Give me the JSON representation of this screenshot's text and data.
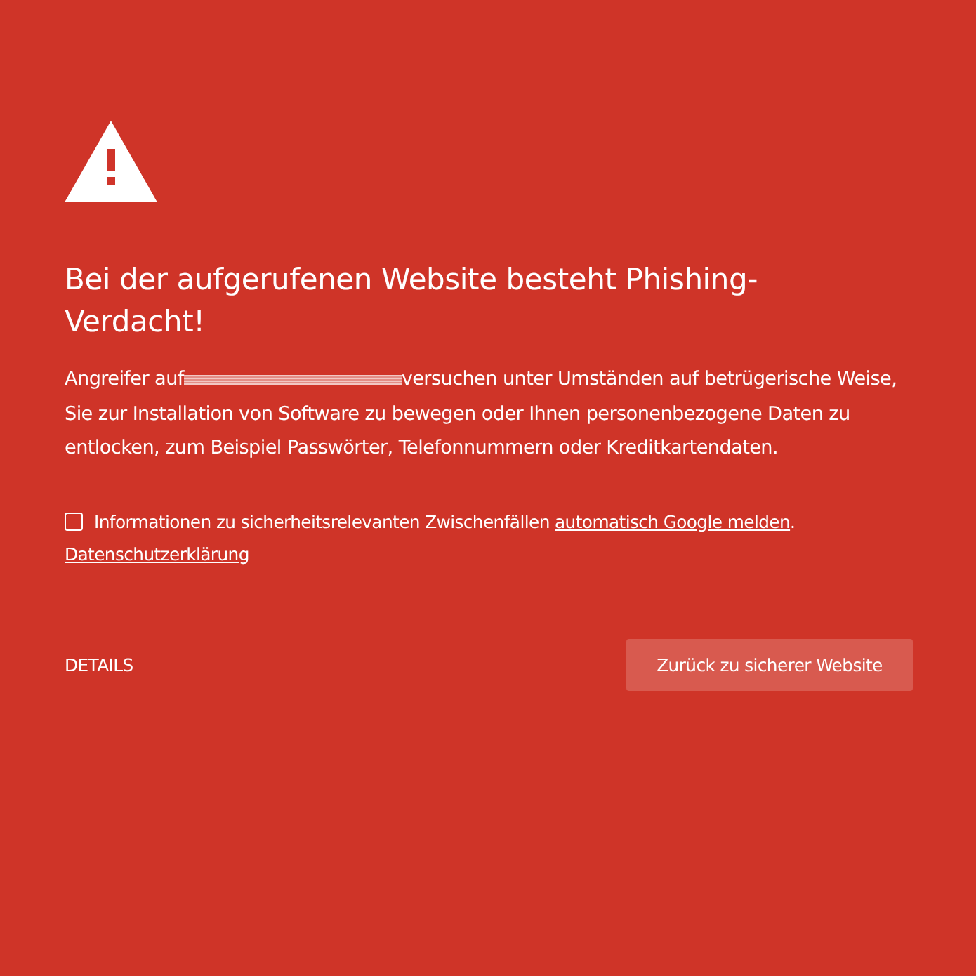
{
  "heading": "Bei der aufgerufenen Website besteht Phishing-Verdacht!",
  "paragraph": {
    "before": "Angreifer auf",
    "after": "versuchen unter Umständen auf betrügerische Weise,",
    "rest": "Sie zur Installation von Software zu bewegen oder Ihnen personenbezogene Daten zu entlocken, zum Beispiel Passwörter, Telefonnummern oder Kreditkartendaten."
  },
  "report": {
    "checked": false,
    "text": "Informationen zu sicherheitsrelevanten Zwischenfällen ",
    "link": "automatisch Google melden",
    "end": "."
  },
  "privacy_link": "Datenschutzerklärung",
  "details_button": "DETAILS",
  "back_button": "Zurück zu sicherer Website"
}
